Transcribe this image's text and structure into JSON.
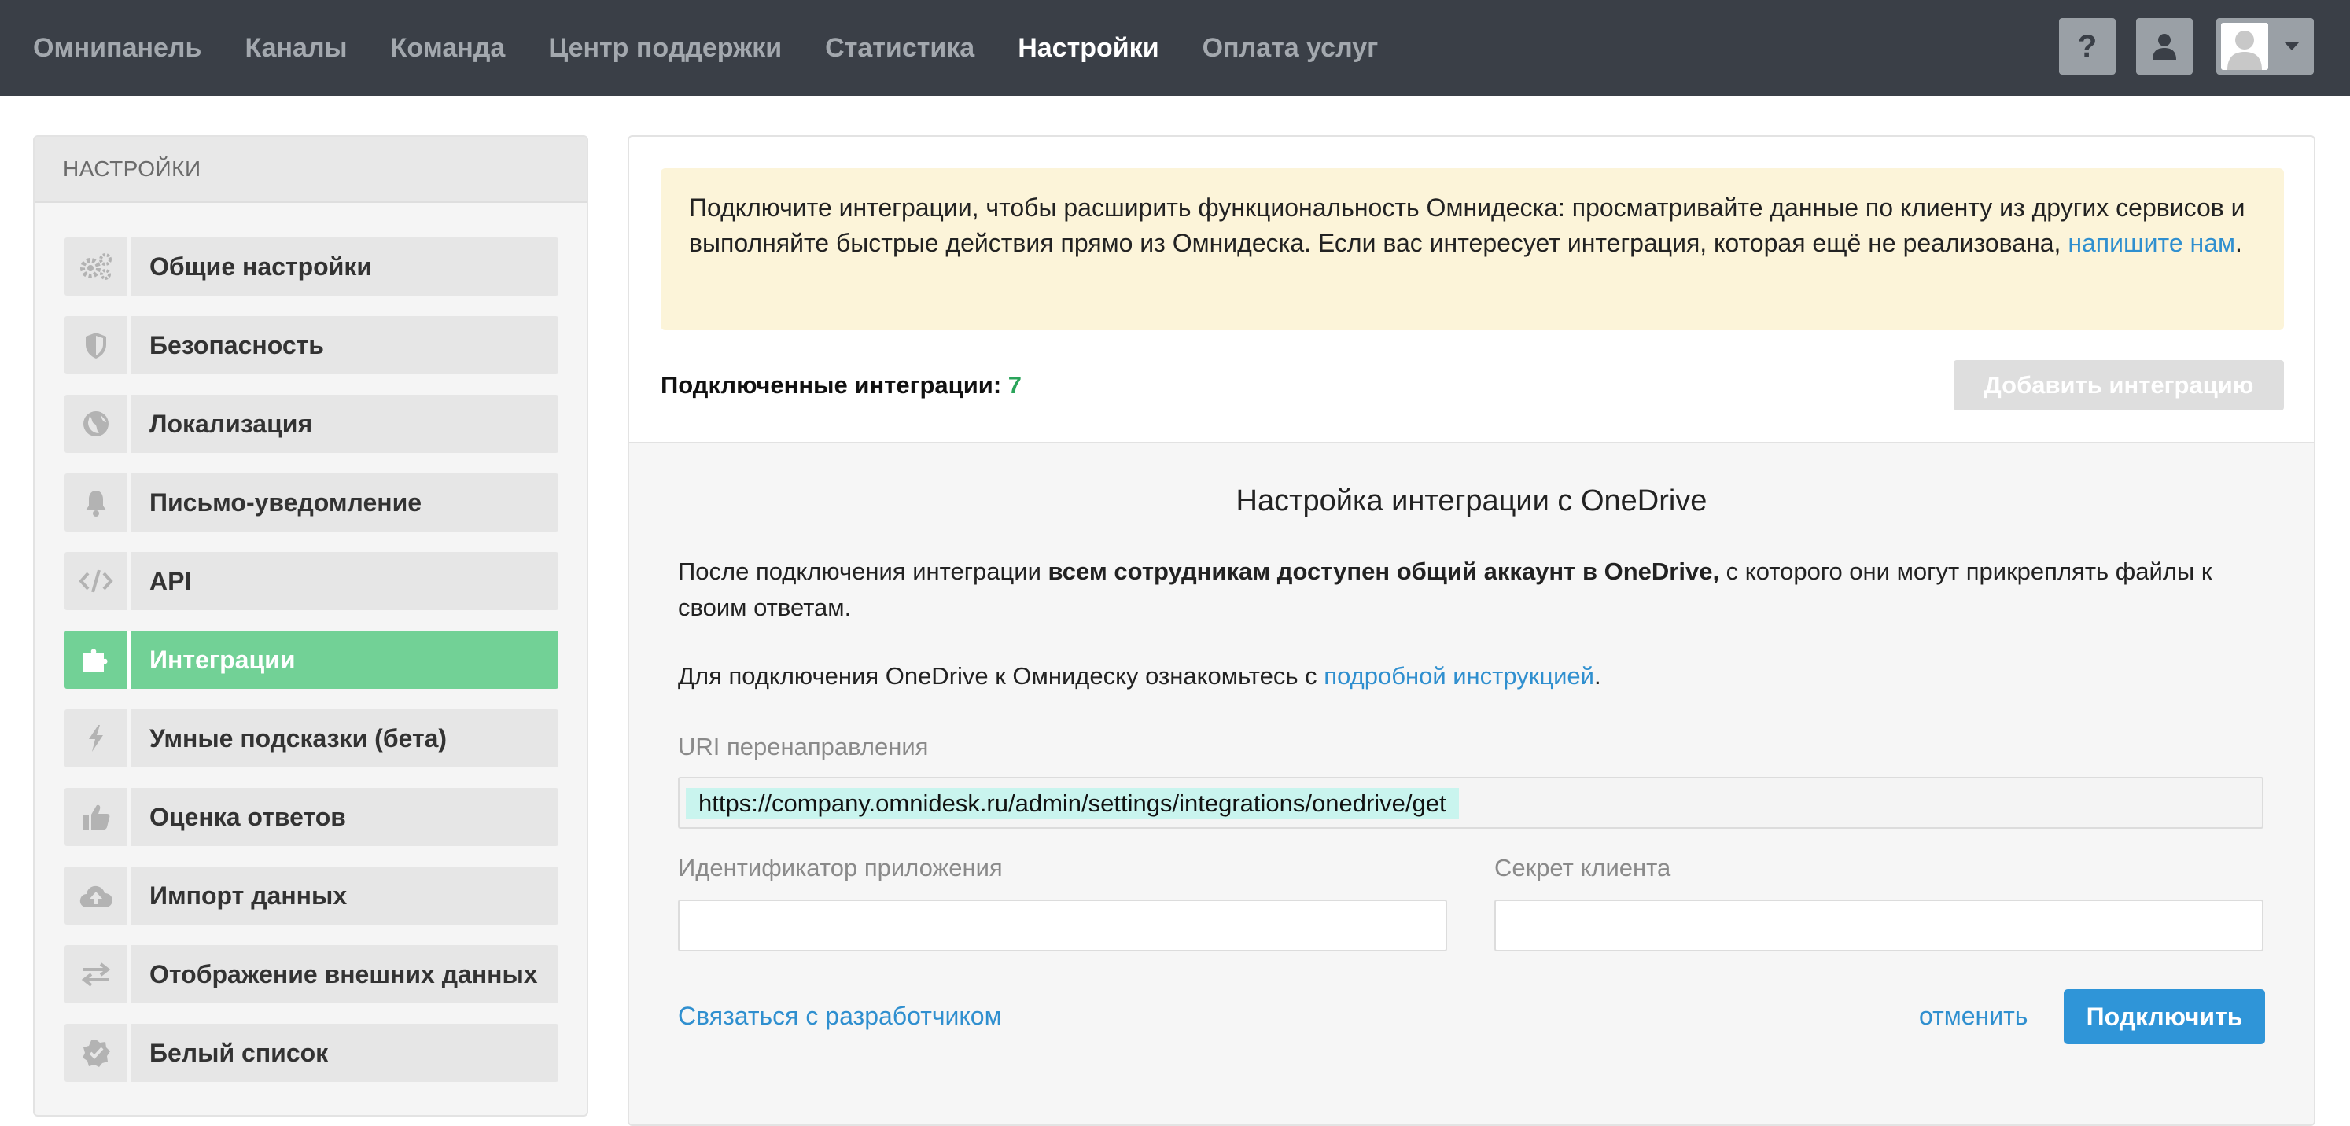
{
  "nav": {
    "links": [
      "Омнипанель",
      "Каналы",
      "Команда",
      "Центр поддержки",
      "Статистика",
      "Настройки",
      "Оплата услуг"
    ],
    "active_index": 5,
    "help_label": "?"
  },
  "sidebar": {
    "title": "НАСТРОЙКИ",
    "items": [
      {
        "label": "Общие настройки",
        "icon": "gears-icon"
      },
      {
        "label": "Безопасность",
        "icon": "shield-icon"
      },
      {
        "label": "Локализация",
        "icon": "globe-icon"
      },
      {
        "label": "Письмо-уведомление",
        "icon": "bell-icon"
      },
      {
        "label": "API",
        "icon": "code-icon"
      },
      {
        "label": "Интеграции",
        "icon": "puzzle-icon",
        "active": true
      },
      {
        "label": "Умные подсказки (бета)",
        "icon": "lightning-icon"
      },
      {
        "label": "Оценка ответов",
        "icon": "thumbs-up-icon"
      },
      {
        "label": "Импорт данных",
        "icon": "cloud-upload-icon"
      },
      {
        "label": "Отображение внешних данных",
        "icon": "exchange-arrows-icon"
      },
      {
        "label": "Белый список",
        "icon": "check-badge-icon"
      }
    ]
  },
  "notice": {
    "text": "Подключите интеграции, чтобы расширить функциональность Омнидеска: просматривайте данные по клиенту из других сервисов и выполняйте быстрые действия прямо из Омнидеска. Если вас интересует интеграция, которая ещё не реализована,",
    "link": "напишите нам",
    "end": "."
  },
  "integrations": {
    "connected_label": "Подключенные интеграции:",
    "connected_count": "7",
    "add_button": "Добавить интеграцию"
  },
  "onedrive": {
    "title": "Настройка интеграции с OneDrive",
    "para1_start": "После подключения интеграции ",
    "para1_bold": "всем сотрудникам доступен общий аккаунт в OneDrive,",
    "para1_end": " с которого они могут прикреплять файлы к своим ответам.",
    "para2_start": "Для подключения OneDrive к Омнидеску ознакомьтесь с ",
    "para2_link": "подробной инструкцией",
    "para2_end": ".",
    "uri_label": "URI перенаправления",
    "uri_value": "https://company.omnidesk.ru/admin/settings/integrations/onedrive/get",
    "app_id_label": "Идентификатор приложения",
    "app_id_value": "",
    "secret_label": "Секрет клиента",
    "secret_value": "",
    "dev_link": "Связаться с разработчиком",
    "cancel": "отменить",
    "connect": "Подключить"
  },
  "colors": {
    "nav_bg": "#3a3f47",
    "active_green": "#72d196",
    "link_blue": "#2f8fcf",
    "notice_bg": "#fcf4d9",
    "count_green": "#2aa45a",
    "connect_blue": "#2f95d8"
  }
}
